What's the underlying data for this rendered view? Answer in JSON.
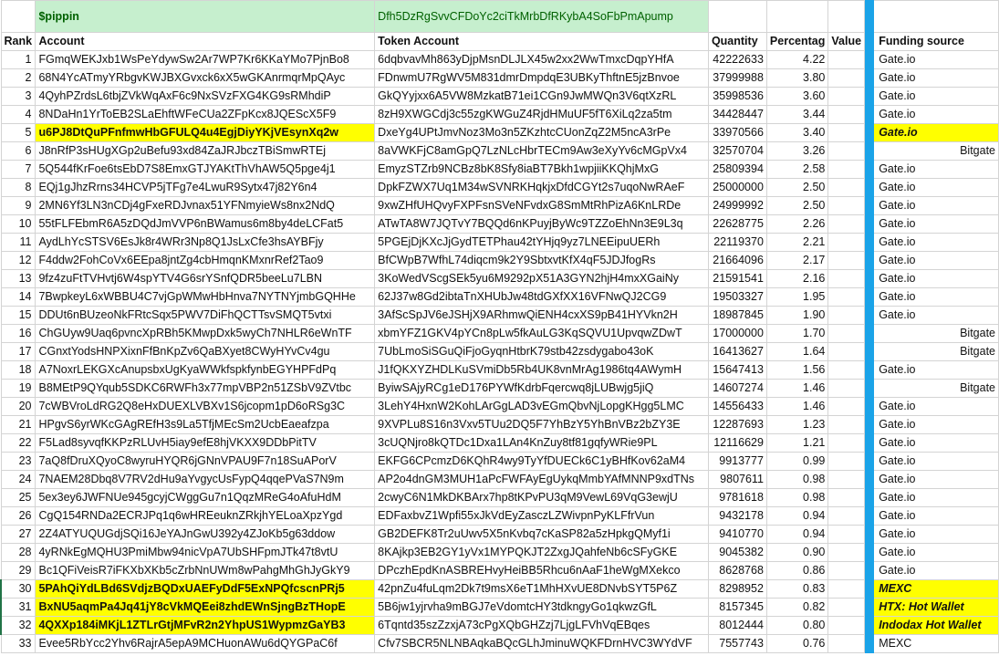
{
  "token": {
    "symbol": "$pippin",
    "mint": "Dfh5DzRgSvvCFDoYc2ciTkMrbDfRKybA4SoFbPmApump"
  },
  "headers": {
    "rank": "Rank",
    "account": "Account",
    "token_account": "Token Account",
    "quantity": "Quantity",
    "percentage": "Percentag",
    "value": "Value",
    "funding": "Funding source"
  },
  "rows": [
    {
      "rank": "1",
      "account": "FGmqWEKJxb1WsPeYdywSw2Ar7WP7Kr6KKaYMo7PjnBo8",
      "token_account": "6dqbvavMh863yDjpMsnDLJLX45w2xx2WwTmxcDqpYHfA",
      "quantity": "42222633",
      "percentage": "4.22",
      "value": "",
      "funding": "Gate.io",
      "highlight": false,
      "align": "left"
    },
    {
      "rank": "2",
      "account": "68N4YcATmyYRbgvKWJBXGvxck6xX5wGKAnrmqrMpQAyc",
      "token_account": "FDnwmU7RgWV5M831dmrDmpdqE3UBKyThftnE5jzBnvoe",
      "quantity": "37999988",
      "percentage": "3.80",
      "value": "",
      "funding": "Gate.io",
      "highlight": false,
      "align": "left"
    },
    {
      "rank": "3",
      "account": "4QyhPZrdsL6tbjZVkWqAxF6c9NxSVzFXG4KG9sRMhdiP",
      "token_account": "GkQYyjxx6A5VW8MzkatB71ei1CGn9JwMWQn3V6qtXzRL",
      "quantity": "35998536",
      "percentage": "3.60",
      "value": "",
      "funding": "Gate.io",
      "highlight": false,
      "align": "left"
    },
    {
      "rank": "4",
      "account": "8NDaHn1YrToEB2SLaEhftWFeCUa2ZFpKcx8JQEScX5F9",
      "token_account": "8zH9XWGCdj3c55zgKWGuZ4RjdHMuUF5fT6XiLq2za5tm",
      "quantity": "34428447",
      "percentage": "3.44",
      "value": "",
      "funding": "Gate.io",
      "highlight": false,
      "align": "left"
    },
    {
      "rank": "5",
      "account": "u6PJ8DtQuPFnfmwHbGFULQ4u4EgjDiyYKjVEsynXq2w",
      "token_account": "DxeYg4UPtJmvNoz3Mo3n5ZKzhtcCUonZqZ2M5ncA3rPe",
      "quantity": "33970566",
      "percentage": "3.40",
      "value": "",
      "funding": "Gate.io",
      "highlight": true,
      "align": "left"
    },
    {
      "rank": "6",
      "account": "J8nRfP3sHUgXGp2uBefu93xd84ZaJRJbczTBiSmwRTEj",
      "token_account": "8aVWKFjC8amGpQ7LzNLcHbrTECm9Aw3eXyYv6cMGpVx4",
      "quantity": "32570704",
      "percentage": "3.26",
      "value": "",
      "funding": "Bitgate",
      "highlight": false,
      "align": "right"
    },
    {
      "rank": "7",
      "account": "5Q544fKrFoe6tsEbD7S8EmxGTJYAKtThVhAW5Q5pge4j1",
      "token_account": "EmyzSTZrb9NCBz8bK8Sfy8iaBT7Bkh1wpjiiKKQhjMxG",
      "quantity": "25809394",
      "percentage": "2.58",
      "value": "",
      "funding": "Gate.io",
      "highlight": false,
      "align": "left"
    },
    {
      "rank": "8",
      "account": "EQj1gJhzRrns34HCVP5jTFg7e4LwuR9Sytx47j82Y6n4",
      "token_account": "DpkFZWX7Uq1M34wSVNRKHqkjxDfdCGYt2s7uqoNwRAeF",
      "quantity": "25000000",
      "percentage": "2.50",
      "value": "",
      "funding": "Gate.io",
      "highlight": false,
      "align": "left"
    },
    {
      "rank": "9",
      "account": "2MN6Yf3LN3nCDj4gFxeRDJvnax51YFNmyieWs8nx2NdQ",
      "token_account": "9xwZHfUHQvyFXPFsnSVeNFvdxG8SmMtRhPizA6KnLRDe",
      "quantity": "24999992",
      "percentage": "2.50",
      "value": "",
      "funding": "Gate.io",
      "highlight": false,
      "align": "left"
    },
    {
      "rank": "10",
      "account": "55tFLFEbmR6A5zDQdJmVVP6nBWamus6m8by4deLCFat5",
      "token_account": "ATwTA8W7JQTvY7BQQd6nKPuyjByWc9TZZoEhNn3E9L3q",
      "quantity": "22628775",
      "percentage": "2.26",
      "value": "",
      "funding": "Gate.io",
      "highlight": false,
      "align": "left"
    },
    {
      "rank": "11",
      "account": "AydLhYcSTSV6EsJk8r4WRr3Np8Q1JsLxCfe3hsAYBFjy",
      "token_account": "5PGEjDjKXcJjGydTETPhau42tYHjq9yz7LNEEipuUERh",
      "quantity": "22119370",
      "percentage": "2.21",
      "value": "",
      "funding": "Gate.io",
      "highlight": false,
      "align": "left"
    },
    {
      "rank": "12",
      "account": "F4ddw2FohCoVx6EEpa8jntZg4cbHmqnKMxnrRef2Tao9",
      "token_account": "BfCWpB7WfhL74diqcm9k2Y9SbtxvtKfX4qF5JDJfogRs",
      "quantity": "21664096",
      "percentage": "2.17",
      "value": "",
      "funding": "Gate.io",
      "highlight": false,
      "align": "left"
    },
    {
      "rank": "13",
      "account": "9fz4zuFtTVHvtj6W4spYTV4G6srYSnfQDR5beeLu7LBN",
      "token_account": "3KoWedVScgSEk5yu6M9292pX51A3GYN2hjH4mxXGaiNy",
      "quantity": "21591541",
      "percentage": "2.16",
      "value": "",
      "funding": "Gate.io",
      "highlight": false,
      "align": "left"
    },
    {
      "rank": "14",
      "account": "7BwpkeyL6xWBBU4C7vjGpWMwHbHnva7NYTNYjmbGQHHe",
      "token_account": "62J37w8Gd2ibtaTnXHUbJw48tdGXfXX16VFNwQJ2CG9",
      "quantity": "19503327",
      "percentage": "1.95",
      "value": "",
      "funding": "Gate.io",
      "highlight": false,
      "align": "left"
    },
    {
      "rank": "15",
      "account": "DDUt6nBUzeoNkFRtcSqx5PWV7DiFhQCTTsvSMQT5vtxi",
      "token_account": "3AfScSpJV6eJSHjX9ARhmwQiENH4cxXS9pB41HYVkn2H",
      "quantity": "18987845",
      "percentage": "1.90",
      "value": "",
      "funding": "Gate.io",
      "highlight": false,
      "align": "left"
    },
    {
      "rank": "16",
      "account": "ChGUyw9Uaq6pvncXpRBh5KMwpDxk5wyCh7NHLR6eWnTF",
      "token_account": "xbmYFZ1GKV4pYCn8pLw5fkAuLG3KqSQVU1UpvqwZDwT",
      "quantity": "17000000",
      "percentage": "1.70",
      "value": "",
      "funding": "Bitgate",
      "highlight": false,
      "align": "right"
    },
    {
      "rank": "17",
      "account": "CGnxtYodsHNPXixnFfBnKpZv6QaBXyet8CWyHYvCv4gu",
      "token_account": "7UbLmoSiSGuQiFjoGyqnHtbrK79stb42zsdygabo43oK",
      "quantity": "16413627",
      "percentage": "1.64",
      "value": "",
      "funding": "Bitgate",
      "highlight": false,
      "align": "right"
    },
    {
      "rank": "18",
      "account": "A7NoxrLEKGXcAnupsbxUgKyaWWkfspkfynbEGYHPFdPq",
      "token_account": "J1fQKXYZHDLKuSVmiDb5Rb4UK8vnMrAg1986tq4AWymH",
      "quantity": "15647413",
      "percentage": "1.56",
      "value": "",
      "funding": "Gate.io",
      "highlight": false,
      "align": "left"
    },
    {
      "rank": "19",
      "account": "B8MEtP9QYqub5SDKC6RWFh3x77mpVBP2n51ZSbV9ZVtbc",
      "token_account": "ByiwSAjyRCg1eD176PYWfKdrbFqercwq8jLUBwjg5jiQ",
      "quantity": "14607274",
      "percentage": "1.46",
      "value": "",
      "funding": "Bitgate",
      "highlight": false,
      "align": "right"
    },
    {
      "rank": "20",
      "account": "7cWBVroLdRG2Q8eHxDUEXLVBXv1S6jcopm1pD6oRSg3C",
      "token_account": "3LehY4HxnW2KohLArGgLAD3vEGmQbvNjLopgKHgg5LMC",
      "quantity": "14556433",
      "percentage": "1.46",
      "value": "",
      "funding": "Gate.io",
      "highlight": false,
      "align": "left"
    },
    {
      "rank": "21",
      "account": "HPgvS6yrWKcGAgREfH3s9La5TfjMEcSm2UcbEaeafzpa",
      "token_account": "9XVPLu8S16n3Vxv5TUu2DQ5F7YhBzY5YhBnVBz2bZY3E",
      "quantity": "12287693",
      "percentage": "1.23",
      "value": "",
      "funding": "Gate.io",
      "highlight": false,
      "align": "left"
    },
    {
      "rank": "22",
      "account": "F5Lad8syvqfKKPzRLUvH5iay9efE8hjVKXX9DDbPitTV",
      "token_account": "3cUQNjro8kQTDc1Dxa1LAn4KnZuy8tf81gqfyWRie9PL",
      "quantity": "12116629",
      "percentage": "1.21",
      "value": "",
      "funding": "Gate.io",
      "highlight": false,
      "align": "left"
    },
    {
      "rank": "23",
      "account": "7aQ8fDruXQyoC8wyruHYQR6jGNnVPAU9F7n18SuAPorV",
      "token_account": "EKFG6CPcmzD6KQhR4wy9TyYfDUECk6C1yBHfKov62aM4",
      "quantity": "9913777",
      "percentage": "0.99",
      "value": "",
      "funding": "Gate.io",
      "highlight": false,
      "align": "left"
    },
    {
      "rank": "24",
      "account": "7NAEM28Dbq8V7RV2dHu9aYvgycUsFypQ4qqePVaS7N9m",
      "token_account": "AP2o4dnGM3MUH1aPcFWFAyEgUykqMmbYAfMNNP9xdTNs",
      "quantity": "9807611",
      "percentage": "0.98",
      "value": "",
      "funding": "Gate.io",
      "highlight": false,
      "align": "left"
    },
    {
      "rank": "25",
      "account": "5ex3ey6JWFNUe945gcyjCWggGu7n1QqzMReG4oAfuHdM",
      "token_account": "2cwyC6N1MkDKBArx7hp8tKPvPU3qM9VewL69VqG3ewjU",
      "quantity": "9781618",
      "percentage": "0.98",
      "value": "",
      "funding": "Gate.io",
      "highlight": false,
      "align": "left"
    },
    {
      "rank": "26",
      "account": "CgQ154RNDa2ECRJPq1q6wHREeuknZRkjhYELoaXpzYgd",
      "token_account": "EDFaxbvZ1Wpfi55xJkVdEyZasczLZWivpnPyKLFfrVun",
      "quantity": "9432178",
      "percentage": "0.94",
      "value": "",
      "funding": "Gate.io",
      "highlight": false,
      "align": "left"
    },
    {
      "rank": "27",
      "account": "2Z4ATYUQUGdjSQi16JeYAJnGwU392y4ZJoKb5g63ddow",
      "token_account": "GB2DEFK8Tr2uUwv5X5nKvbq7cKaSP82a5zHpkgQMyf1i",
      "quantity": "9410770",
      "percentage": "0.94",
      "value": "",
      "funding": "Gate.io",
      "highlight": false,
      "align": "left"
    },
    {
      "rank": "28",
      "account": "4yRNkEgMQHU3PmiMbw94nicVpA7UbSHFpmJTk47t8vtU",
      "token_account": "8KAjkp3EB2GY1yVx1MYPQKJT2ZxgJQahfeNb6cSFyGKE",
      "quantity": "9045382",
      "percentage": "0.90",
      "value": "",
      "funding": "Gate.io",
      "highlight": false,
      "align": "left"
    },
    {
      "rank": "29",
      "account": "Bc1QFiVeisR7iFKXbXKb5cZrbNnUWm8wPahgMhGhJyGkY9",
      "token_account": "DPczhEpdKnASBREHvyHeiBB5Rhcu6nAaF1heWgMXekco",
      "quantity": "8628768",
      "percentage": "0.86",
      "value": "",
      "funding": "Gate.io",
      "highlight": false,
      "align": "left"
    },
    {
      "rank": "30",
      "account": "5PAhQiYdLBd6SVdjzBQDxUAEFyDdF5ExNPQfcscnPRj5",
      "token_account": "42pnZu4fuLqm2Dk7t9msX6eT1MhHXvUE8DNvbSYT5P6Z",
      "quantity": "8298952",
      "percentage": "0.83",
      "value": "",
      "funding": "MEXC",
      "highlight": true,
      "align": "left"
    },
    {
      "rank": "31",
      "account": "BxNU5aqmPa4Jq41jY8cVkMQEei8zhdEWnSjngBzTHopE",
      "token_account": "5B6jw1yjrvha9mBGJ7eVdomtcHY3tdkngyGo1qkwzGfL",
      "quantity": "8157345",
      "percentage": "0.82",
      "value": "",
      "funding": "HTX: Hot Wallet",
      "highlight": true,
      "align": "left"
    },
    {
      "rank": "32",
      "account": "4QXXp184iMKjL1ZTLrGtjMFvR2n2YhpUS1WypmzGaYB3",
      "token_account": "6Tqntd35szZzxjA73cPgXQbGHZzj7LjgLFVhVqEBqes",
      "quantity": "8012444",
      "percentage": "0.80",
      "value": "",
      "funding": "Indodax Hot Wallet",
      "highlight": true,
      "align": "left"
    },
    {
      "rank": "33",
      "account": "Evee5RbYcc2Yhv6RajrA5epA9MCHuonAWu6dQYGPaC6f",
      "token_account": "Cfv7SBCR5NLNBAqkaBQcGLhJminuWQKFDrnHVC3WYdVF",
      "quantity": "7557743",
      "percentage": "0.76",
      "value": "",
      "funding": "MEXC",
      "highlight": false,
      "align": "left"
    }
  ]
}
